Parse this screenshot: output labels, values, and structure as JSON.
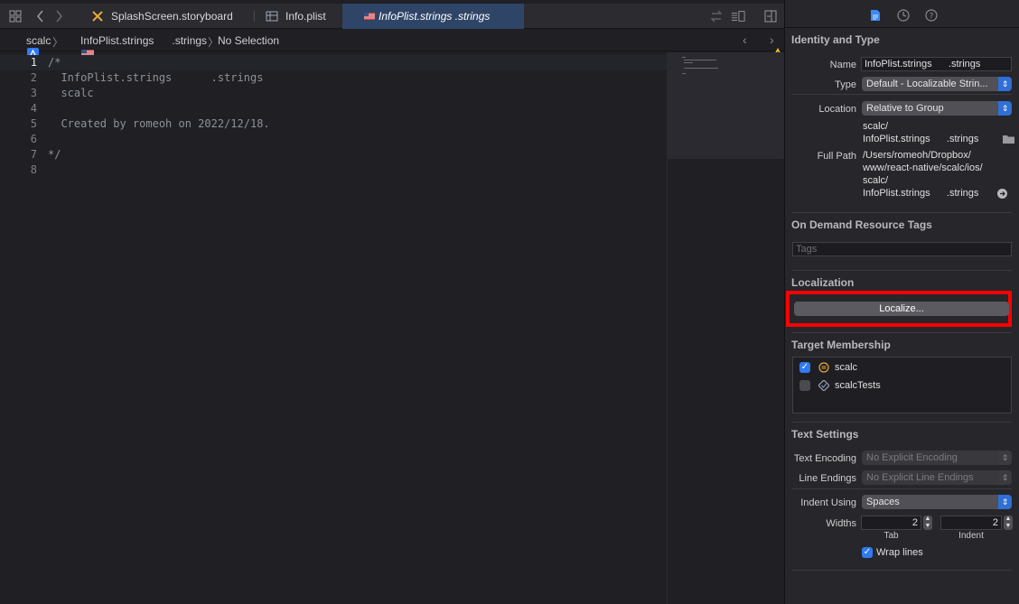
{
  "tabs": [
    {
      "label": "SplashScreen.storyboard",
      "icon": "storyboard-icon"
    },
    {
      "label": "Info.plist",
      "icon": "plist-icon"
    },
    {
      "label": "InfoPlist.strings      .strings",
      "icon": "strings-file-icon"
    }
  ],
  "jumpbar": {
    "project": "scalc",
    "file": "InfoPlist.strings      .strings",
    "selection": "No Selection"
  },
  "code": {
    "line_numbers": [
      "1",
      "2",
      "3",
      "4",
      "5",
      "6",
      "7",
      "8"
    ],
    "lines": [
      "/*",
      "  InfoPlist.strings      .strings",
      "  scalc",
      "",
      "  Created by romeoh on 2022/12/18.",
      "",
      "*/",
      ""
    ]
  },
  "inspector": {
    "identity": {
      "title": "Identity and Type",
      "name_label": "Name",
      "name_value": "InfoPlist.strings      .strings",
      "type_label": "Type",
      "type_value": "Default - Localizable Strin...",
      "location_label": "Location",
      "location_value": "Relative to Group",
      "location_path_1": "scalc/",
      "location_path_2": "InfoPlist.strings      .strings",
      "fullpath_label": "Full Path",
      "fullpath_1": "/Users/romeoh/Dropbox/",
      "fullpath_2": "www/react-native/scalc/ios/",
      "fullpath_3": "scalc/",
      "fullpath_4": "InfoPlist.strings      .strings"
    },
    "odr": {
      "title": "On Demand Resource Tags",
      "tags_placeholder": "Tags"
    },
    "localization": {
      "title": "Localization",
      "button": "Localize..."
    },
    "target": {
      "title": "Target Membership",
      "items": [
        {
          "name": "scalc",
          "checked": true
        },
        {
          "name": "scalcTests",
          "checked": false
        }
      ]
    },
    "text_settings": {
      "title": "Text Settings",
      "encoding_label": "Text Encoding",
      "encoding_value": "No Explicit Encoding",
      "line_endings_label": "Line Endings",
      "line_endings_value": "No Explicit Line Endings",
      "indent_label": "Indent Using",
      "indent_value": "Spaces",
      "widths_label": "Widths",
      "tab_value": "2",
      "indent_width_value": "2",
      "tab_label": "Tab",
      "indent_sub_label": "Indent",
      "wrap_label": "Wrap lines"
    }
  }
}
